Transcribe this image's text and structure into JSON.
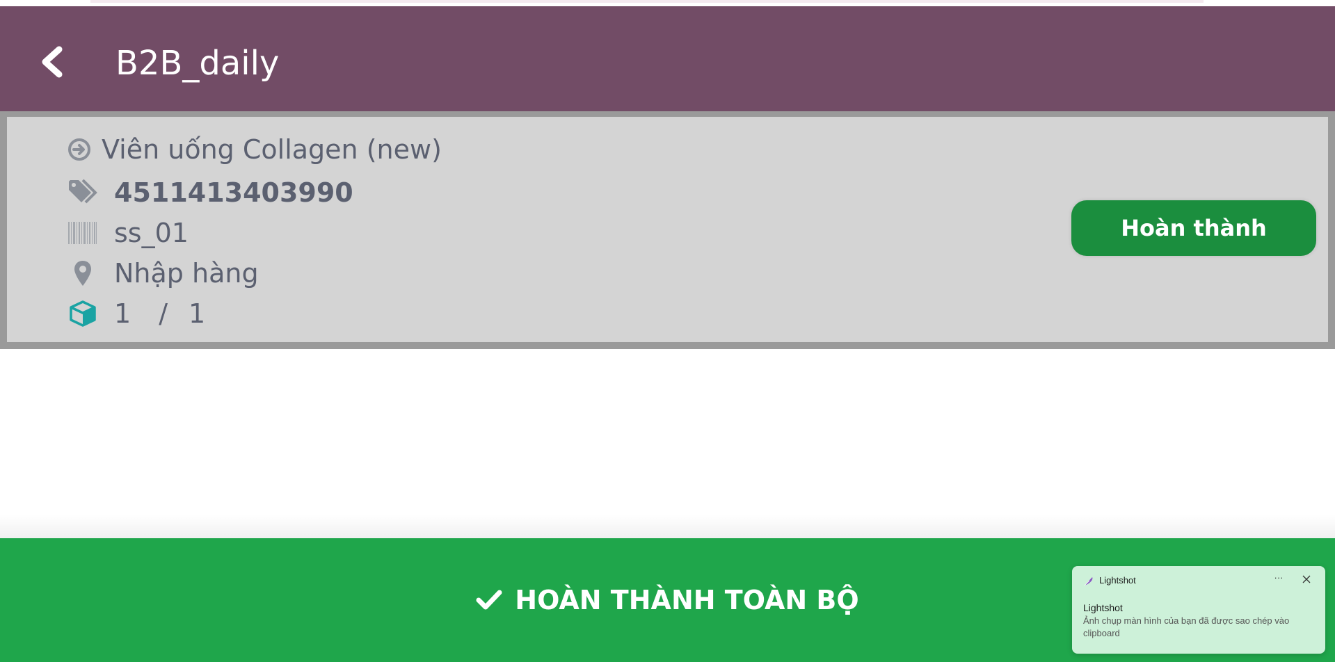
{
  "header": {
    "title": "B2B_daily",
    "background": "#724c66"
  },
  "item": {
    "product_name": "Viên uống Collagen (new)",
    "code": "4511413403990",
    "serial": "ss_01",
    "location": "Nhập hàng",
    "qty_done": "1",
    "qty_separator": "/",
    "qty_total": "1",
    "done_button_label": "Hoàn thành",
    "card_background": "#d4d4d4",
    "accent_icon_color": "#1aa3a3"
  },
  "footer": {
    "button_label": "HOÀN THÀNH TOÀN BỘ",
    "background": "#1fa64b"
  },
  "toast": {
    "app_name": "Lightshot",
    "more_label": "···",
    "title": "Lightshot",
    "message": "Ảnh chụp màn hình của bạn đã được sao chép vào clipboard"
  },
  "icons": {
    "back": "chevron-left-icon",
    "product": "arrow-circle-right-icon",
    "code": "tags-icon",
    "serial": "barcode-icon",
    "location": "map-marker-icon",
    "qty": "cube-icon",
    "footer": "check-icon",
    "toast_logo": "feather-icon",
    "toast_close": "close-icon"
  }
}
